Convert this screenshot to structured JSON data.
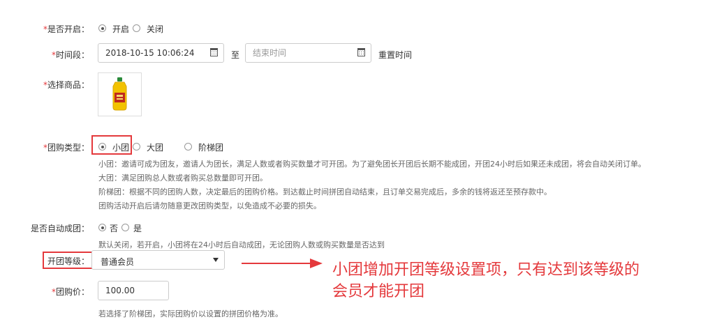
{
  "enable": {
    "label_prefix": "*",
    "label": "是否开启：",
    "options": [
      "开启",
      "关闭"
    ],
    "selected": 0
  },
  "time": {
    "label_prefix": "*",
    "label": "时间段：",
    "start_value": "2018-10-15 10:06:24",
    "separator": "至",
    "end_placeholder": "结束时间",
    "reset_label": "重置时间"
  },
  "goods": {
    "label_prefix": "*",
    "label": "选择商品："
  },
  "group_type": {
    "label_prefix": "*",
    "label": "团购类型：",
    "options": [
      "小团",
      "大团",
      "阶梯团"
    ],
    "selected": 0,
    "hints": [
      "小团：邀请可成为团友，邀请人为团长，满足人数或者购买数量才可开团。为了避免团长开团后长期不能成团，开团24小时后如果还未成团，将会自动关闭订单。",
      "大团：满足团购总人数或者购买总数量即可开团。",
      "阶梯团：根据不同的团购人数，决定最后的团购价格。到达截止时间拼团自动结束，且订单交易完成后，多余的钱将返还至预存款中。",
      "团购活动开启后请勿随意更改团购类型，以免造成不必要的损失。"
    ]
  },
  "auto_group": {
    "label": "是否自动成团：",
    "options": [
      "否",
      "是"
    ],
    "selected": 0,
    "hint": "默认关闭，若开启，小团将在24小时后自动成团，无论团购人数或购买数量是否达到"
  },
  "level": {
    "label": "开团等级：",
    "selected": "普通会员"
  },
  "price": {
    "label_prefix": "*",
    "label": "团购价：",
    "value": "100.00",
    "hint": "若选择了阶梯团，实际团购价以设置的拼团价格为准。"
  },
  "annotation": {
    "line1": "小团增加开团等级设置项，只有达到该等级的",
    "line2": "会员才能开团",
    "color": "#e4393c"
  }
}
